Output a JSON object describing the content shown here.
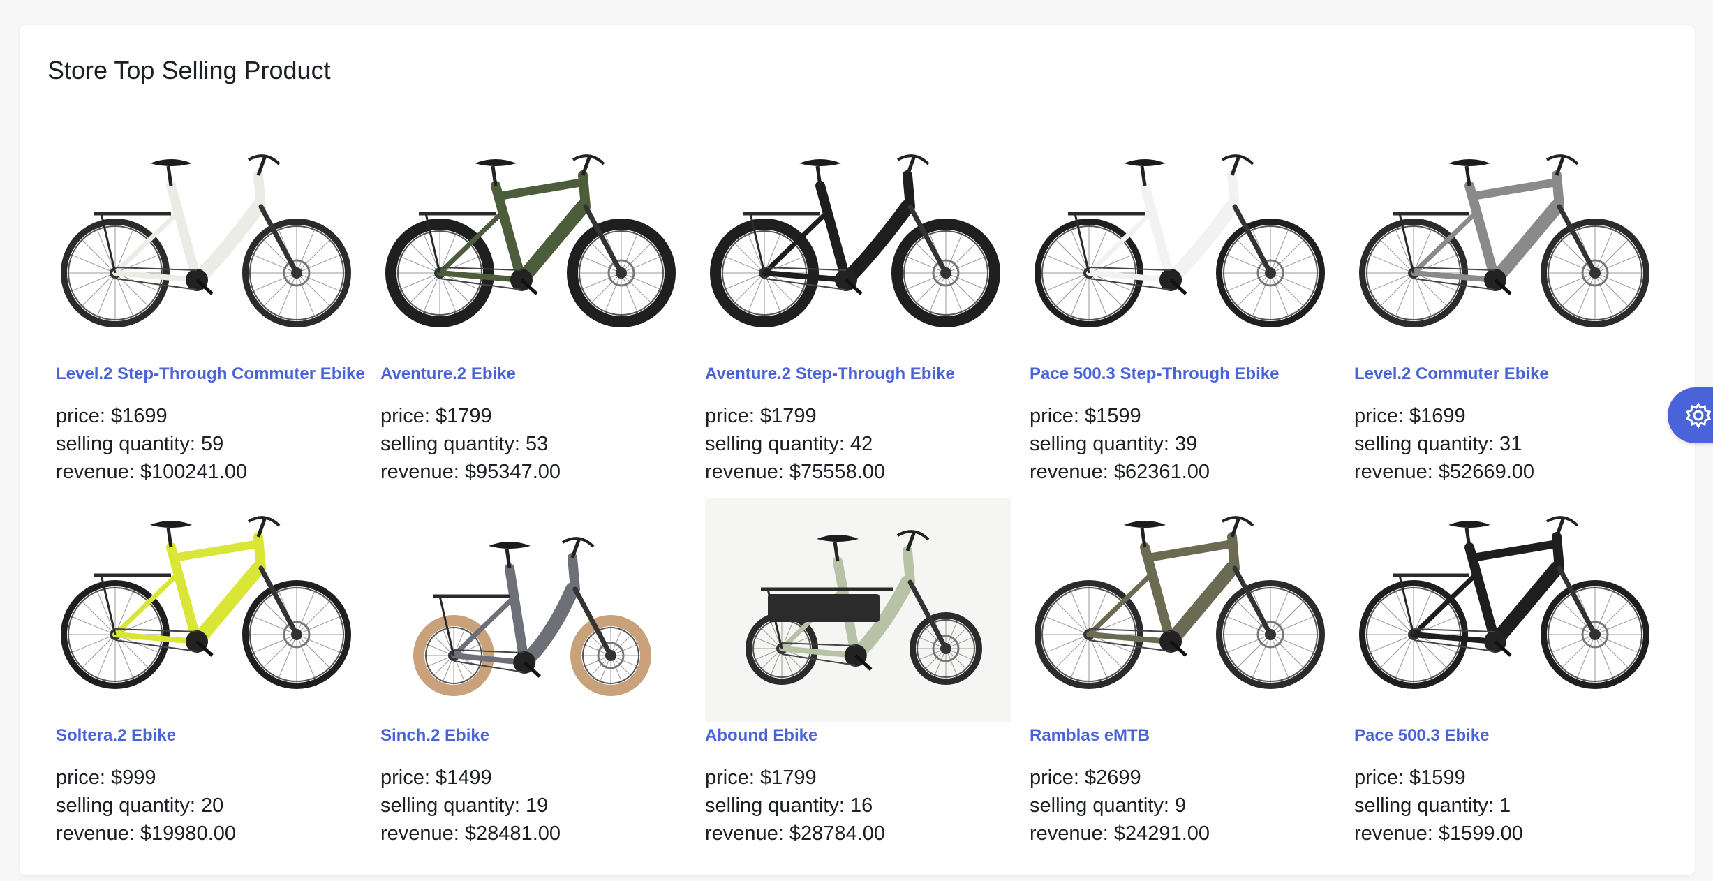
{
  "card": {
    "title": "Store Top Selling Product"
  },
  "labels": {
    "price": "price: ",
    "quantity": "selling quantity: ",
    "revenue": "revenue: "
  },
  "colors": {
    "link": "#4a63d8",
    "settings_fab": "#4a63d8"
  },
  "settings_fab": {
    "icon": "gear-icon"
  },
  "products": [
    {
      "name": "Level.2 Step-Through Commuter Ebike",
      "price": "$1699",
      "quantity": "59",
      "revenue": "$100241.00",
      "frame_color": "#ecebe6",
      "tire": "#2b2b2b",
      "style": "step",
      "fat": false
    },
    {
      "name": "Aventure.2 Ebike",
      "price": "$1799",
      "quantity": "53",
      "revenue": "$95347.00",
      "frame_color": "#4b5d3a",
      "tire": "#1f1f1f",
      "style": "high",
      "fat": true
    },
    {
      "name": "Aventure.2 Step-Through Ebike",
      "price": "$1799",
      "quantity": "42",
      "revenue": "$75558.00",
      "frame_color": "#1e1e1e",
      "tire": "#1f1f1f",
      "style": "step",
      "fat": true
    },
    {
      "name": "Pace 500.3 Step-Through Ebike",
      "price": "$1599",
      "quantity": "39",
      "revenue": "$62361.00",
      "frame_color": "#f2f2f2",
      "tire": "#1f1f1f",
      "style": "step",
      "fat": false
    },
    {
      "name": "Level.2 Commuter Ebike",
      "price": "$1699",
      "quantity": "31",
      "revenue": "$52669.00",
      "frame_color": "#8b8a88",
      "tire": "#2b2b2b",
      "style": "high",
      "fat": false
    },
    {
      "name": "Soltera.2 Ebike",
      "price": "$999",
      "quantity": "20",
      "revenue": "$19980.00",
      "frame_color": "#d9e635",
      "tire": "#1f1f1f",
      "style": "high",
      "fat": false
    },
    {
      "name": "Sinch.2 Ebike",
      "price": "$1499",
      "quantity": "19",
      "revenue": "$28481.00",
      "frame_color": "#6e7079",
      "tire": "#c9a27c",
      "style": "fold",
      "fat": true
    },
    {
      "name": "Abound Ebike",
      "price": "$1799",
      "quantity": "16",
      "revenue": "$28784.00",
      "frame_color": "#b8c2a6",
      "tire": "#2b2b2b",
      "style": "cargo",
      "fat": false
    },
    {
      "name": "Ramblas eMTB",
      "price": "$2699",
      "quantity": "9",
      "revenue": "$24291.00",
      "frame_color": "#6b6a52",
      "tire": "#2b2b2b",
      "style": "mtb",
      "fat": false
    },
    {
      "name": "Pace 500.3 Ebike",
      "price": "$1599",
      "quantity": "1",
      "revenue": "$1599.00",
      "frame_color": "#1e1e1e",
      "tire": "#1f1f1f",
      "style": "high",
      "fat": false
    }
  ]
}
